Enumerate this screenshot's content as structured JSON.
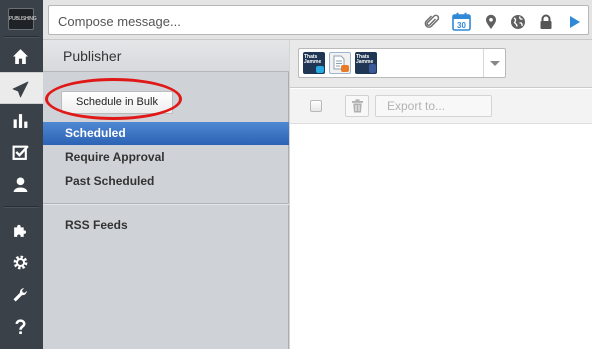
{
  "nav": {
    "logo_text": "PUBLISHING",
    "items": [
      {
        "name": "home-icon",
        "active": false
      },
      {
        "name": "send-icon",
        "active": true
      },
      {
        "name": "analytics-icon",
        "active": false
      },
      {
        "name": "assignments-icon",
        "active": false
      },
      {
        "name": "contacts-icon",
        "active": false
      },
      {
        "name": "apps-puzzle-icon",
        "active": false
      },
      {
        "name": "settings-gear-icon",
        "active": false
      },
      {
        "name": "tools-wrench-icon",
        "active": false
      },
      {
        "name": "help-question-icon",
        "active": false
      }
    ]
  },
  "compose": {
    "placeholder": "Compose message...",
    "calendar_day": "30",
    "icons": [
      "attachment-icon",
      "calendar-icon",
      "location-pin-icon",
      "globe-icon",
      "lock-icon",
      "send-arrow-icon"
    ]
  },
  "publisher": {
    "title": "Publisher",
    "bulk_button": "Schedule in Bulk",
    "items": [
      "Scheduled",
      "Require Approval",
      "Past Scheduled"
    ],
    "active_item": "Scheduled",
    "rss_label": "RSS Feeds"
  },
  "main": {
    "profiles": [
      {
        "name": "twitter-profile-avatar",
        "line1": "Thats",
        "line2": "Jamme",
        "badge_color": "#29a9e1"
      },
      {
        "name": "wordpress-profile-avatar",
        "line1": "",
        "line2": "",
        "badge_color": "#e97a27"
      },
      {
        "name": "facebook-profile-avatar",
        "line1": "Thats",
        "line2": "Jamme",
        "badge_color": "#3b5998"
      }
    ],
    "export_label": "Export to..."
  },
  "colors": {
    "nav_bg": "#3b4148",
    "active_item": "#2c63b5",
    "annotation_circle": "#e01818"
  }
}
